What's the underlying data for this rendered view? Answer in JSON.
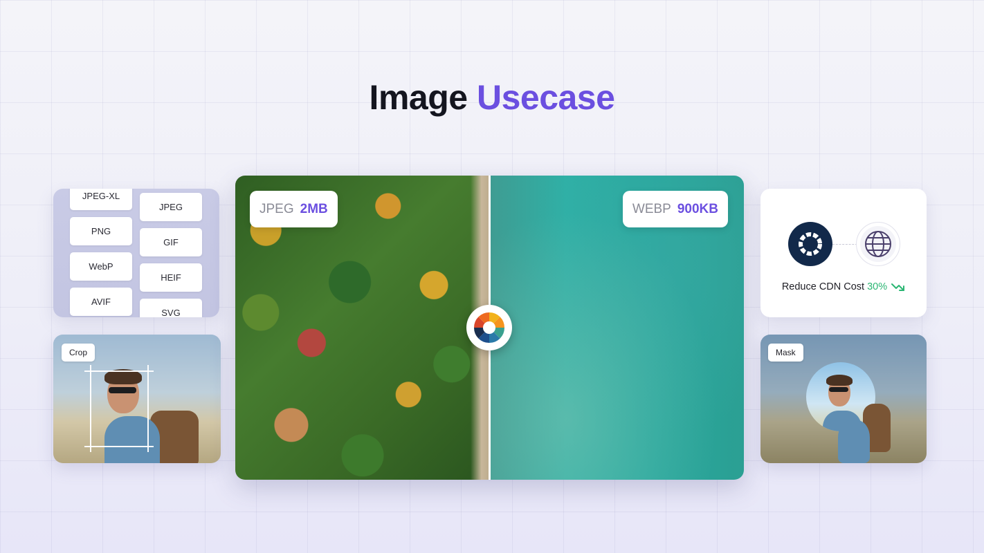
{
  "title": {
    "main": "Image",
    "accent": "Usecase"
  },
  "formats": {
    "column_left": [
      "JPEG-XL",
      "PNG",
      "WebP",
      "AVIF"
    ],
    "column_right": [
      "JPEG",
      "GIF",
      "HEIF",
      "SVG"
    ]
  },
  "crop_card": {
    "label": "Crop"
  },
  "mask_card": {
    "label": "Mask"
  },
  "comparison": {
    "left": {
      "format": "JPEG",
      "size": "2MB"
    },
    "right": {
      "format": "WEBP",
      "size": "900KB"
    },
    "handle_icon": "color-wheel-icon"
  },
  "cdn_card": {
    "text": "Reduce CDN Cost",
    "percent": "30%",
    "trend_icon": "trending-down-icon",
    "logo_icon": "aperture-logo-icon",
    "globe_icon": "globe-icon"
  },
  "colors": {
    "accent": "#6b4fe0",
    "title": "#14151f",
    "success": "#2bb673",
    "logo_bg": "#12294a"
  }
}
